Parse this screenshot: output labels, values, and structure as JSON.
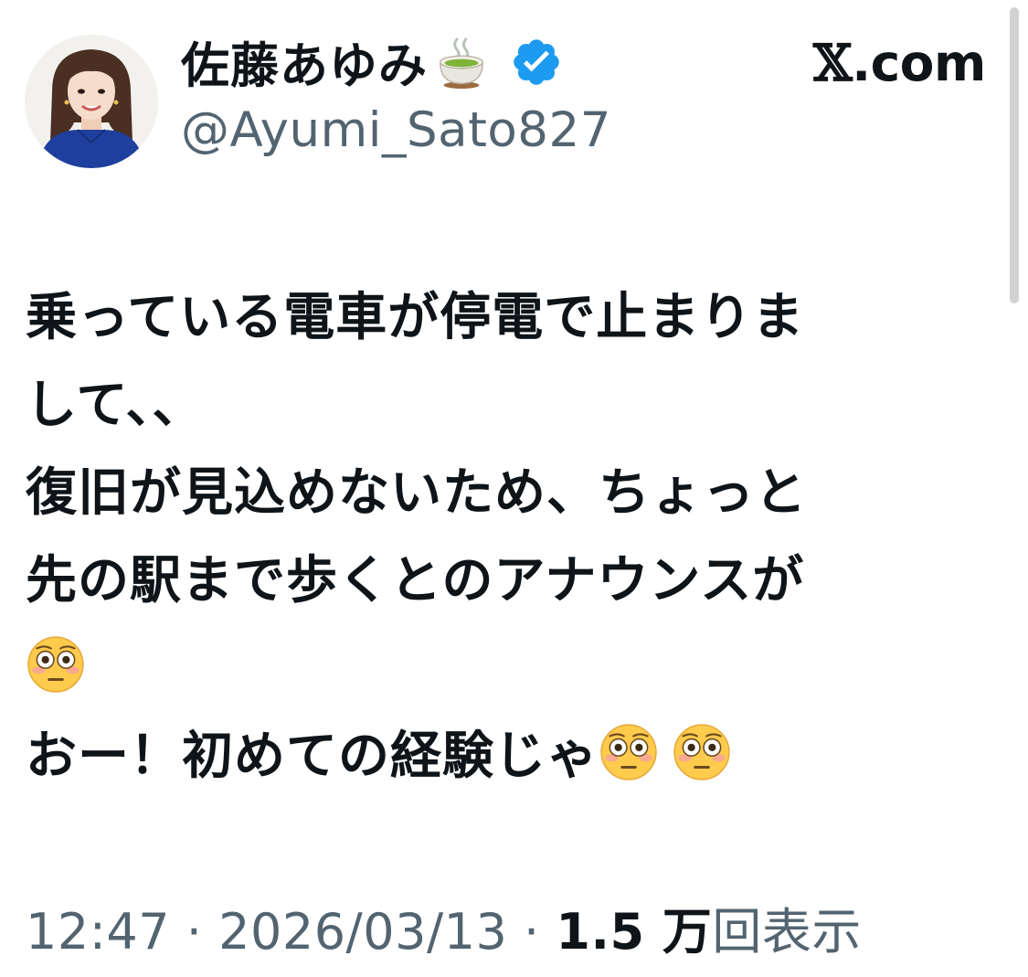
{
  "author": {
    "display_name": "佐藤あゆみ",
    "name_emoji": "hot-tea-emoji",
    "verified_icon": "verified-badge-icon",
    "handle": "@Ayumi_Sato827",
    "avatar": "profile-photo"
  },
  "source": {
    "x_mark": "𝕏",
    "domain": ".com"
  },
  "tweet": {
    "lines": [
      "乗っている電車が停電で止まりま",
      "して、、",
      "復旧が見込めないため、ちょっと",
      "先の駅まで歩くとのアナウンスが",
      "",
      "おー！初めての経験じゃ"
    ],
    "emoji": "flushed-face-emoji"
  },
  "meta": {
    "time": "12:47",
    "separator": " · ",
    "date": "2026/03/13",
    "views_count": "1.5 万",
    "views_label": "回表示"
  },
  "colors": {
    "text": "#0f1419",
    "secondary": "#536471",
    "verified": "#1d9bf0"
  }
}
